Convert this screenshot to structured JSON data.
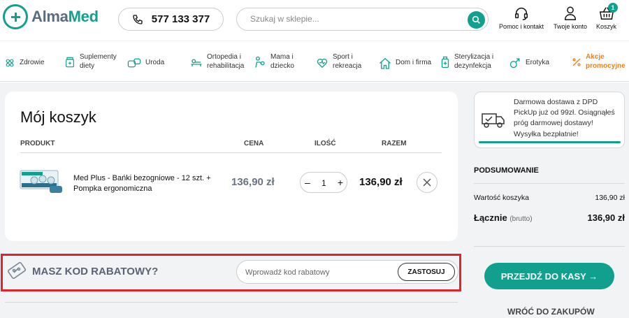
{
  "header": {
    "logo_part1": "Alma",
    "logo_part2": "Med",
    "phone": "577 133 377",
    "search_placeholder": "Szukaj w sklepie...",
    "help_label": "Pomoc i kontakt",
    "account_label": "Twoje konto",
    "cart_label": "Koszyk",
    "cart_count": "1"
  },
  "nav": {
    "items": [
      {
        "label": "Zdrowie",
        "icon": "health-icon"
      },
      {
        "label": "Suplementy diety",
        "icon": "supplements-icon"
      },
      {
        "label": "Uroda",
        "icon": "beauty-icon"
      },
      {
        "label": "Ortopedia i rehabilitacja",
        "icon": "orthopedics-icon"
      },
      {
        "label": "Mama i dziecko",
        "icon": "mother-child-icon"
      },
      {
        "label": "Sport i rekreacja",
        "icon": "sport-icon"
      },
      {
        "label": "Dom i firma",
        "icon": "home-icon"
      },
      {
        "label": "Sterylizacja i dezynfekcja",
        "icon": "sterilization-icon"
      },
      {
        "label": "Erotyka",
        "icon": "erotica-icon"
      },
      {
        "label": "Akcje promocyjne",
        "icon": "percent-icon"
      }
    ]
  },
  "cart": {
    "title": "Mój koszyk",
    "col_product": "PRODUKT",
    "col_price": "CENA",
    "col_qty": "ILOŚĆ",
    "col_total": "RAZEM",
    "item": {
      "name": "Med Plus - Bańki bezogniowe - 12 szt. + Pompka ergonomiczna",
      "price": "136,90 zł",
      "qty": "1",
      "total": "136,90 zł",
      "minus": "–",
      "plus": "+"
    }
  },
  "discount": {
    "label": "MASZ KOD RABATOWY?",
    "placeholder": "Wprowadź kod rabatowy",
    "apply": "ZASTOSUJ"
  },
  "shipping": {
    "text": "Darmowa dostawa z DPD PickUp już od 99zł. Osiągnąłeś próg darmowej dostawy! Wysyłka bezpłatnie!"
  },
  "summary": {
    "title": "PODSUMOWANIE",
    "cart_value_label": "Wartość koszyka",
    "cart_value": "136,90 zł",
    "total_label": "Łącznie",
    "total_note": "(brutto)",
    "total": "136,90 zł",
    "checkout": "PRZEJDŹ DO KASY →",
    "back": "WRÓĆ DO ZAKUPÓW"
  },
  "colors": {
    "accent": "#12a08e",
    "promo": "#f08019",
    "highlight_border": "#e0242c"
  }
}
